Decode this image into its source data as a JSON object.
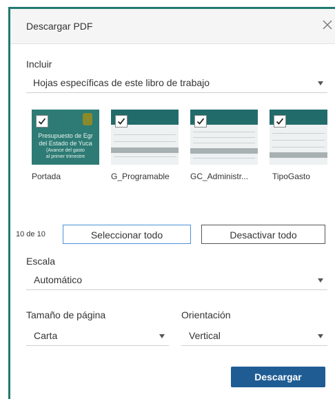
{
  "dialog": {
    "title": "Descargar PDF",
    "close_icon": "close-icon"
  },
  "include": {
    "label": "Incluir",
    "value": "Hojas específicas de este libro de trabajo"
  },
  "sheets": [
    {
      "label": "Portada",
      "checked": true,
      "cover_lines": [
        "Presupuesto de Egr",
        "del Estado de Yuca",
        "(Avance del gasto",
        "al primer trimestre"
      ]
    },
    {
      "label": "G_Programable",
      "checked": true
    },
    {
      "label": "GC_Administr...",
      "checked": true
    },
    {
      "label": "TipoGasto",
      "checked": true
    }
  ],
  "selection": {
    "count": "10 de 10",
    "select_all": "Seleccionar todo",
    "deselect_all": "Desactivar todo"
  },
  "scale": {
    "label": "Escala",
    "value": "Automático"
  },
  "page_size": {
    "label": "Tamaño de página",
    "value": "Carta"
  },
  "orientation": {
    "label": "Orientación",
    "value": "Vertical"
  },
  "download_button": "Descargar",
  "colors": {
    "accent_teal": "#1f7a6e",
    "primary_button": "#1f5c94",
    "focus_border": "#4a90d9"
  }
}
